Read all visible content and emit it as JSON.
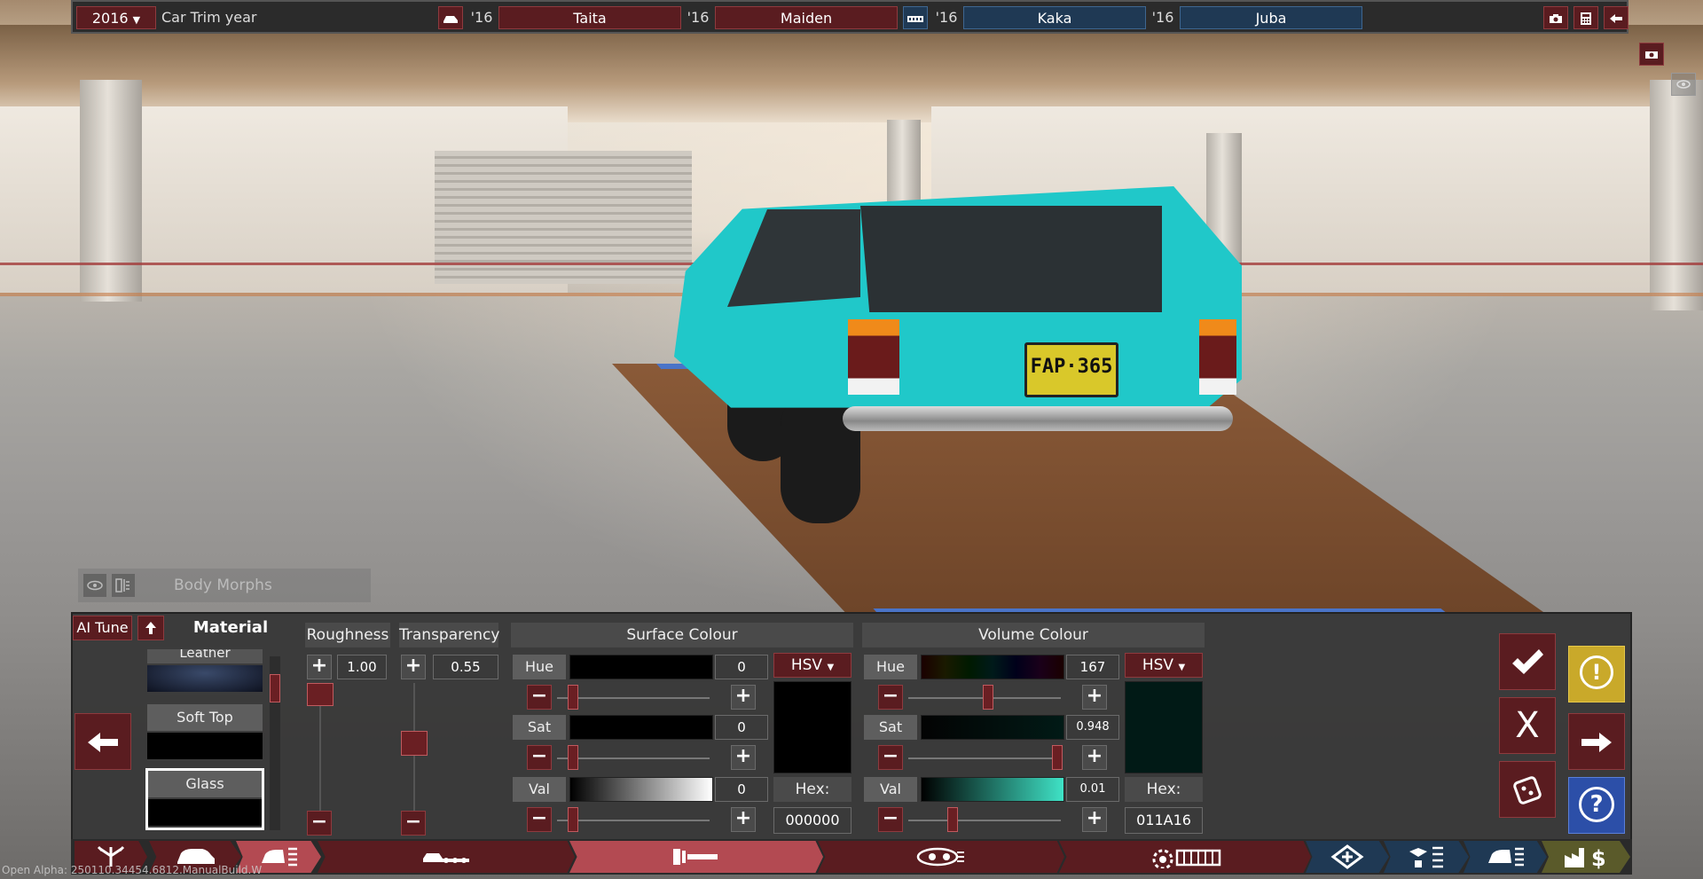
{
  "topbar": {
    "year": "2016",
    "year_caret": "▼",
    "year_label": "Car Trim year",
    "car1_year": "'16",
    "car1_name": "Taita",
    "car2_year": "'16",
    "car2_name": "Maiden",
    "car3_year": "'16",
    "car3_name": "Kaka",
    "car4_year": "'16",
    "car4_name": "Juba"
  },
  "scene": {
    "plate_text": "FAP·365"
  },
  "body_morphs": {
    "label": "Body Morphs"
  },
  "material_panel": {
    "ai_tune": "AI Tune",
    "title": "Material",
    "items": [
      {
        "label": "Leather"
      },
      {
        "label": "Soft Top"
      },
      {
        "label": "Glass"
      }
    ],
    "selected": "Glass"
  },
  "roughness": {
    "label": "Roughness",
    "value": "1.00",
    "level": 1.0
  },
  "transparency": {
    "label": "Transparency",
    "value": "0.55",
    "level": 0.55
  },
  "surface": {
    "title": "Surface Colour",
    "mode": "HSV",
    "hue_label": "Hue",
    "hue_value": "0",
    "sat_label": "Sat",
    "sat_value": "0",
    "val_label": "Val",
    "val_value": "0",
    "hex_label": "Hex:",
    "hex_value": "000000",
    "swatch": "#000000"
  },
  "volume": {
    "title": "Volume Colour",
    "mode": "HSV",
    "hue_label": "Hue",
    "hue_value": "167",
    "sat_label": "Sat",
    "sat_value": "0.948",
    "val_label": "Val",
    "val_value": "0.01",
    "hex_label": "Hex:",
    "hex_value": "011A16",
    "swatch": "#011A16"
  },
  "controls": {
    "plus": "+",
    "minus": "−",
    "confirm": "✔",
    "cancel": "X",
    "warning": "!",
    "help": "?",
    "prev": "←",
    "next": "→"
  },
  "footer": {
    "build_text": "Open Alpha: 250110.34454.6812.ManualBuild.W"
  },
  "colors": {
    "accent_red": "#5a1c20",
    "accent_blue": "#1f3954",
    "warning_yellow": "#c9a92a",
    "help_blue": "#2c4fa8"
  }
}
